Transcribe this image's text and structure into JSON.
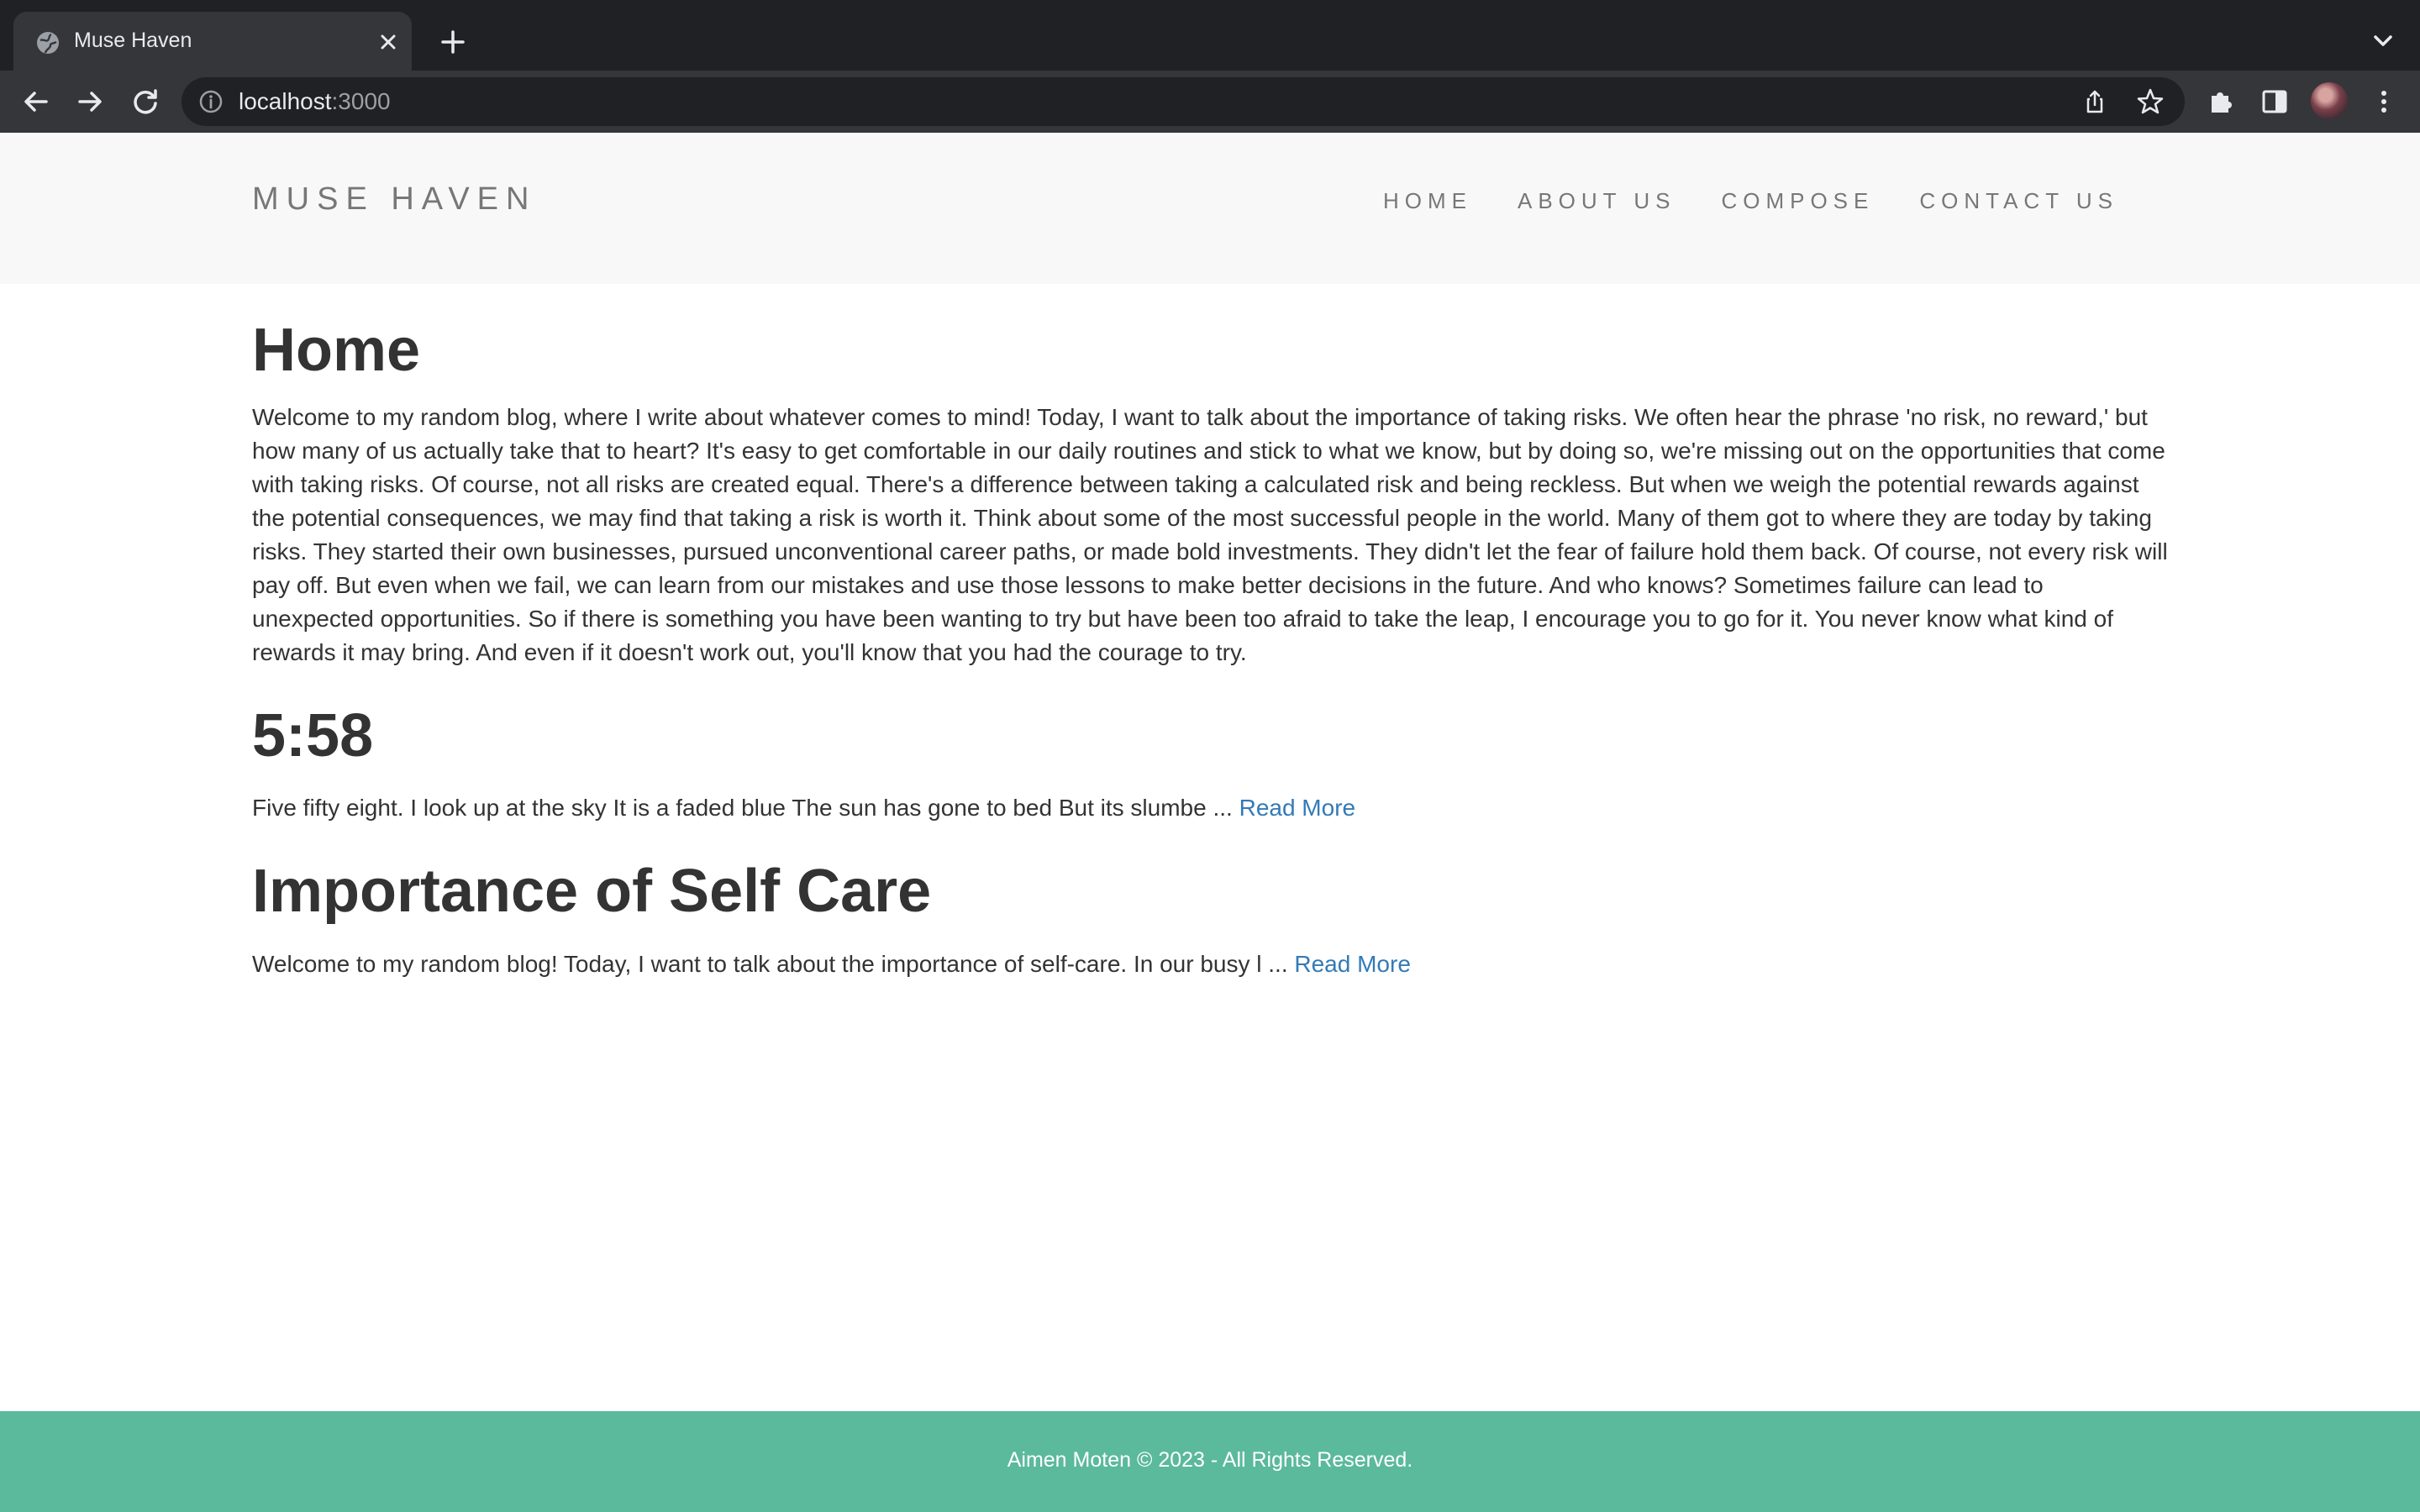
{
  "browser": {
    "tab_title": "Muse Haven",
    "url_host": "localhost",
    "url_port": ":3000",
    "icons": [
      "globe-icon",
      "close-icon",
      "plus-icon",
      "chevron-down-icon",
      "back-arrow-icon",
      "forward-arrow-icon",
      "reload-icon",
      "info-icon",
      "share-icon",
      "star-icon",
      "puzzle-icon",
      "side-panel-icon",
      "avatar",
      "more-vert-icon"
    ]
  },
  "site": {
    "brand": "MUSE HAVEN",
    "nav": [
      "HOME",
      "ABOUT US",
      "COMPOSE",
      "CONTACT US"
    ]
  },
  "home": {
    "heading": "Home",
    "intro": "Welcome to my random blog, where I write about whatever comes to mind! Today, I want to talk about the importance of taking risks. We often hear the phrase 'no risk, no reward,' but how many of us actually take that to heart? It's easy to get comfortable in our daily routines and stick to what we know, but by doing so, we're missing out on the opportunities that come with taking risks. Of course, not all risks are created equal. There's a difference between taking a calculated risk and being reckless. But when we weigh the potential rewards against the potential consequences, we may find that taking a risk is worth it. Think about some of the most successful people in the world. Many of them got to where they are today by taking risks. They started their own businesses, pursued unconventional career paths, or made bold investments. They didn't let the fear of failure hold them back. Of course, not every risk will pay off. But even when we fail, we can learn from our mistakes and use those lessons to make better decisions in the future. And who knows? Sometimes failure can lead to unexpected opportunities. So if there is something you have been wanting to try but have been too afraid to take the leap, I encourage you to go for it. You never know what kind of rewards it may bring. And even if it doesn't work out, you'll know that you had the courage to try."
  },
  "posts": [
    {
      "title": "5:58",
      "excerpt": "Five fifty eight. I look up at the sky It is a faded blue The sun has gone to bed But its slumbe ... ",
      "link": "Read More"
    },
    {
      "title": "Importance of Self Care",
      "excerpt": "Welcome to my random blog! Today, I want to talk about the importance of self-care. In our busy l ... ",
      "link": "Read More"
    }
  ],
  "footer": {
    "text": "Aimen Moten © 2023 - All Rights Reserved."
  },
  "colors": {
    "chrome_dark": "#202124",
    "chrome_tab": "#35363a",
    "nav_bg": "#f8f8f8",
    "link": "#337ab7",
    "footer_bg": "#5bb99c"
  }
}
